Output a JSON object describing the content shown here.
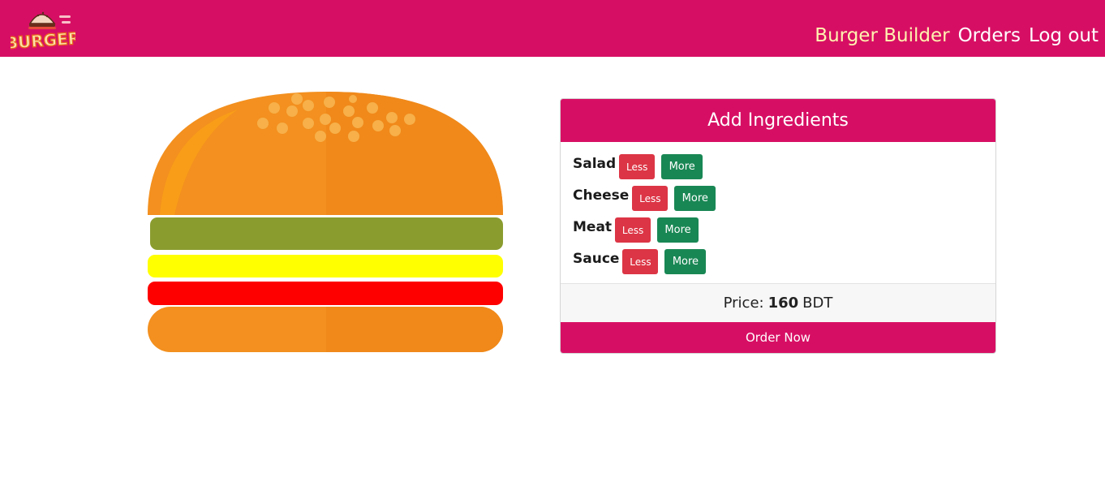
{
  "header": {
    "logo_text": "BURGER",
    "nav": [
      {
        "label": "Burger Builder",
        "active": true
      },
      {
        "label": "Orders",
        "active": false
      },
      {
        "label": "Log out",
        "active": false
      }
    ]
  },
  "colors": {
    "brand": "#d70f64",
    "nav_active": "#fff3b0",
    "less_button": "#dc3545",
    "more_button": "#198754",
    "bun": "#f3901f",
    "salad": "#8a9c2e",
    "cheese": "#ffff00",
    "meat": "#ff0000"
  },
  "burger": {
    "layers": [
      "bread-top",
      "salad",
      "cheese",
      "meat",
      "bread-bottom"
    ]
  },
  "controls": {
    "title": "Add Ingredients",
    "ingredients": [
      {
        "label": "Salad",
        "less": "Less",
        "more": "More"
      },
      {
        "label": "Cheese",
        "less": "Less",
        "more": "More"
      },
      {
        "label": "Meat",
        "less": "Less",
        "more": "More"
      },
      {
        "label": "Sauce",
        "less": "Less",
        "more": "More"
      }
    ],
    "price_label": "Price:",
    "price_value": "160",
    "currency": "BDT",
    "order_button": "Order Now"
  }
}
